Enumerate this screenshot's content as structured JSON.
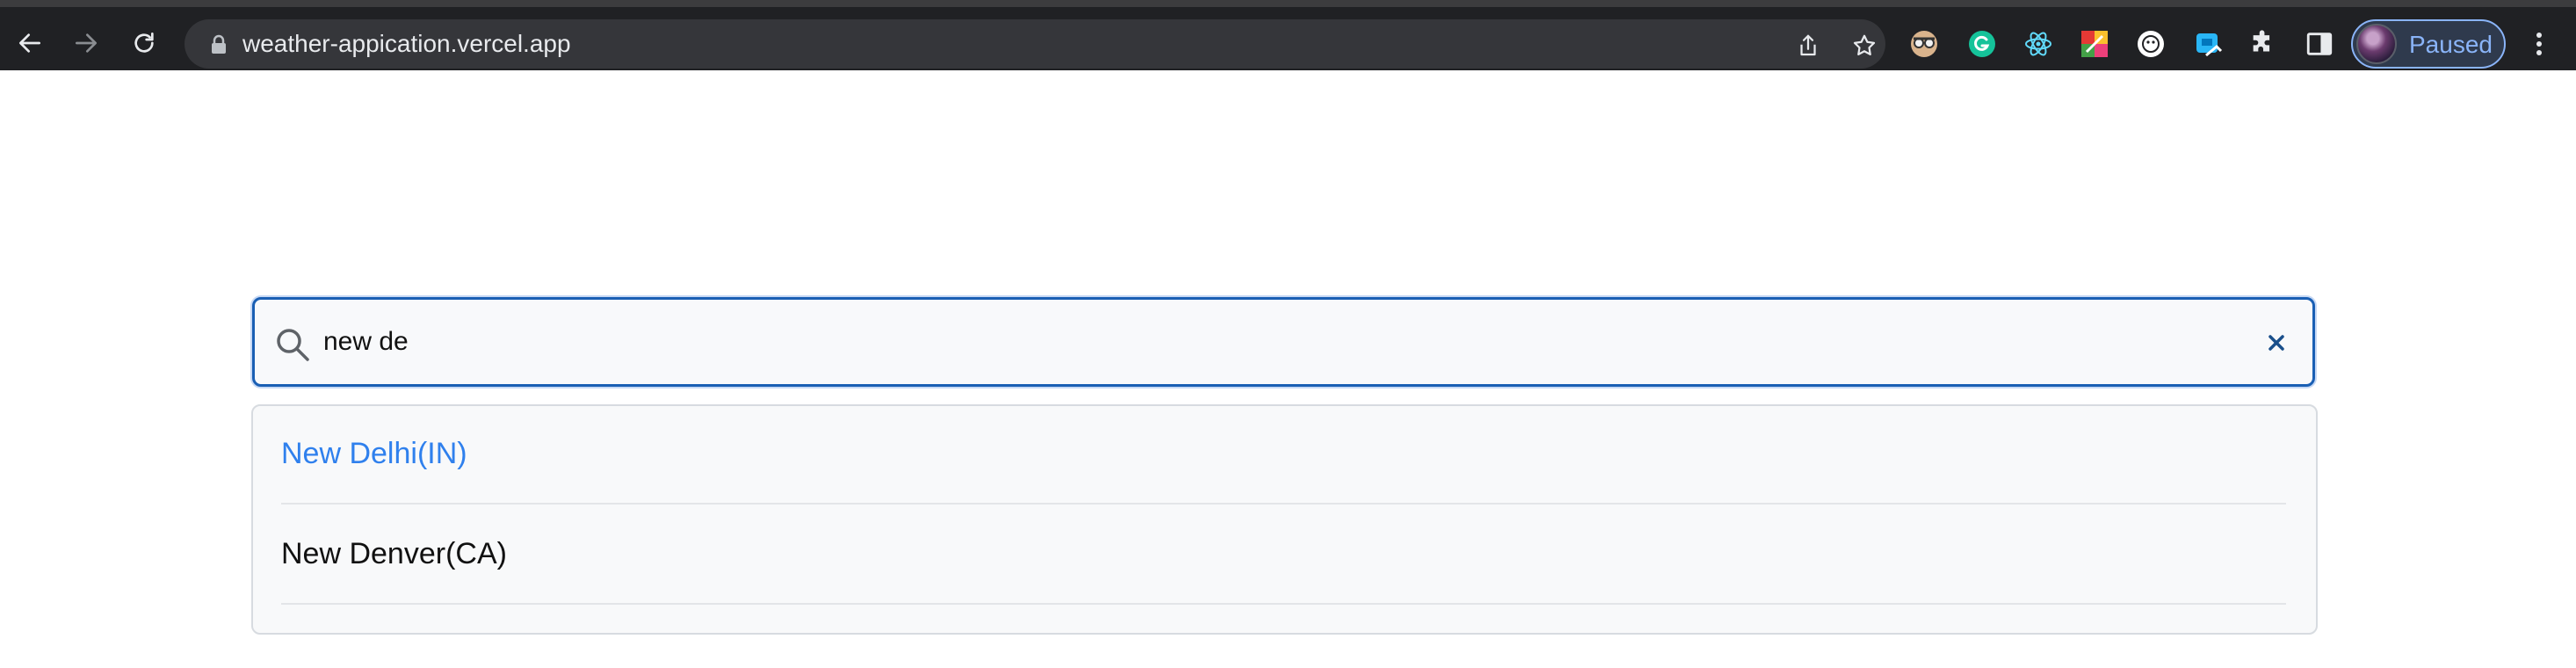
{
  "browser": {
    "url": "weather-appication.vercel.app",
    "profile_label": "Paused",
    "extensions": [
      "spy-glasses-icon",
      "grammarly-icon",
      "react-devtools-icon",
      "color-palette-icon",
      "session-buddy-icon",
      "screen-capture-icon",
      "puzzle-icon"
    ]
  },
  "search": {
    "value": "new de",
    "placeholder": ""
  },
  "results": {
    "items": [
      {
        "label": "New Delhi(IN)",
        "state": "highlighted"
      },
      {
        "label": "New Denver(CA)",
        "state": "normal"
      }
    ]
  },
  "colors": {
    "accent": "#2f80ed",
    "input_border": "#1a5fb4",
    "chrome_bg": "#202124"
  }
}
